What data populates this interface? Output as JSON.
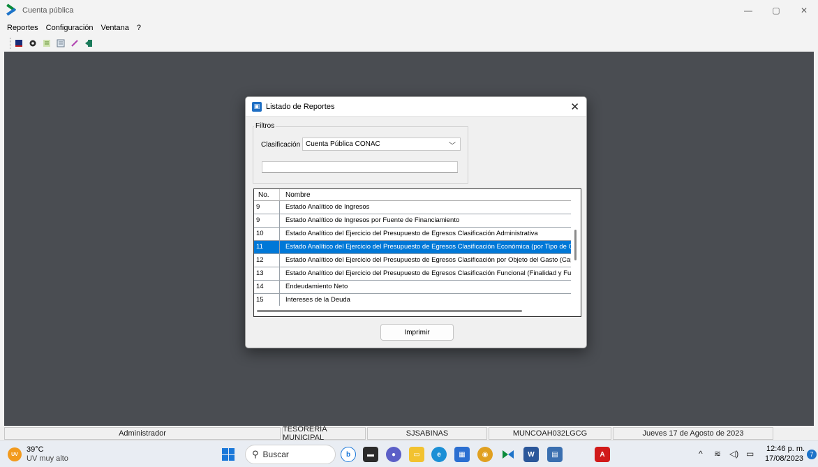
{
  "window": {
    "title": "Cuenta pública",
    "controls": [
      "—",
      "▢",
      "✕"
    ]
  },
  "menu": [
    "Reportes",
    "Configuración",
    "Ventana",
    "?"
  ],
  "dialog": {
    "title": "Listado de Reportes",
    "filters_legend": "Filtros",
    "classification_label": "Clasificación",
    "classification_value": "Cuenta Pública CONAC",
    "search_value": "",
    "columns": {
      "no": "No.",
      "name": "Nombre"
    },
    "rows": [
      {
        "no": "9",
        "name": "Estado Analítico de Ingresos",
        "selected": false
      },
      {
        "no": "9",
        "name": "Estado Analítico de Ingresos por Fuente de Financiamiento",
        "selected": false
      },
      {
        "no": "10",
        "name": "Estado Analítico del Ejercicio del Presupuesto de Egresos Clasificación Administrativa",
        "selected": false
      },
      {
        "no": "11",
        "name": "Estado Analítico del Ejercicio del Presupuesto de Egresos Clasificación Económica (por Tipo de Gas",
        "selected": true
      },
      {
        "no": "12",
        "name": "Estado Analítico del Ejercicio del Presupuesto de Egresos Clasificación por Objeto del Gasto (Capítu",
        "selected": false
      },
      {
        "no": "13",
        "name": "Estado Analítico del Ejercicio del Presupuesto de Egresos Clasificación Funcional (Finalidad y Funci",
        "selected": false
      },
      {
        "no": "14",
        "name": "Endeudamiento Neto",
        "selected": false
      },
      {
        "no": "15",
        "name": "Intereses de la Deuda",
        "selected": false
      }
    ],
    "print_label": "Imprimir"
  },
  "statusbar": [
    "Administrador",
    "TESORERIA MUNICIPAL",
    "SJSABINAS",
    "MUNCOAH032LGCG",
    "Jueves 17 de Agosto de 2023"
  ],
  "taskbar": {
    "weather_badge": "UV",
    "weather_temp": "39°C",
    "weather_desc": "UV muy alto",
    "search_label": "Buscar",
    "time": "12:46 p. m.",
    "date": "17/08/2023",
    "notifications": "7"
  },
  "colors": {
    "selection": "#0078d7",
    "workspace": "#4a4d52"
  }
}
